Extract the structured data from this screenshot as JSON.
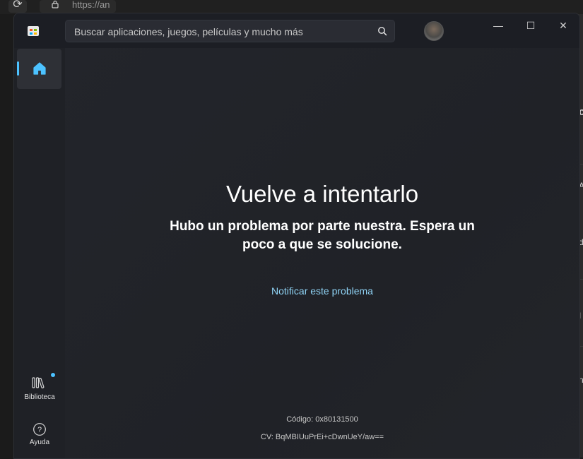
{
  "browser": {
    "reload_icon": "reload-icon",
    "lock_icon": "lock-icon",
    "url_text": "https://an"
  },
  "background_page": {
    "fragments": [
      "c",
      "A",
      "d",
      "I",
      "n"
    ]
  },
  "store": {
    "search": {
      "placeholder": "Buscar aplicaciones, juegos, películas y mucho más"
    },
    "window_controls": {
      "minimize": "—",
      "maximize": "☐",
      "close": "✕"
    },
    "sidebar": {
      "home_icon": "home-icon",
      "library_label": "Biblioteca",
      "help_label": "Ayuda",
      "help_glyph": "?"
    },
    "error": {
      "title": "Vuelve a intentarlo",
      "message": "Hubo un problema por parte nuestra. Espera un poco a que se solucione.",
      "report_link": "Notificar este problema",
      "code": "Código: 0x80131500",
      "cv": "CV: BqMBIUuPrEi+cDwnUeY/aw=="
    },
    "colors": {
      "accent": "#4cc2ff",
      "link": "#8fd3f5",
      "background": "#202227"
    }
  }
}
